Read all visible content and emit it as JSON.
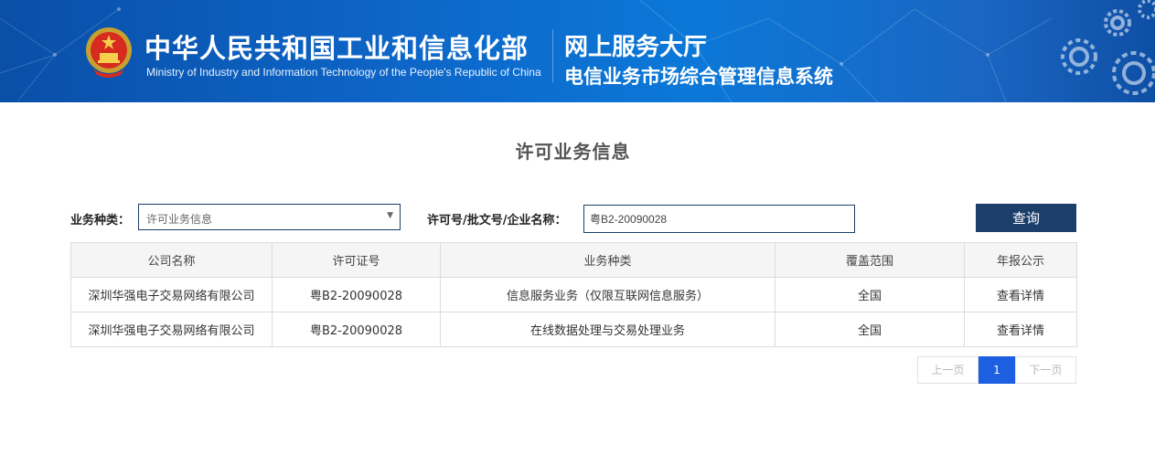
{
  "header": {
    "ministry_cn": "中华人民共和国工业和信息化部",
    "ministry_en": "Ministry of Industry and Information Technology of the People's Republic of China",
    "hall_title": "网上服务大厅",
    "system_title": "电信业务市场综合管理信息系统"
  },
  "page": {
    "title": "许可业务信息"
  },
  "filters": {
    "type_label": "业务种类：",
    "type_value": "许可业务信息",
    "license_label": "许可号/批文号/企业名称：",
    "license_value": "粤B2-20090028",
    "query_button": "查询"
  },
  "table": {
    "headers": [
      "公司名称",
      "许可证号",
      "业务种类",
      "覆盖范围",
      "年报公示"
    ],
    "rows": [
      [
        "深圳华强电子交易网络有限公司",
        "粤B2-20090028",
        "信息服务业务（仅限互联网信息服务）",
        "全国",
        "查看详情"
      ],
      [
        "深圳华强电子交易网络有限公司",
        "粤B2-20090028",
        "在线数据处理与交易处理业务",
        "全国",
        "查看详情"
      ]
    ]
  },
  "pagination": {
    "prev": "上一页",
    "current": "1",
    "next": "下一页"
  },
  "colors": {
    "banner_blue": "#0d66c8",
    "dark_navy": "#1b3f6a",
    "page_active": "#1c5fe0"
  }
}
